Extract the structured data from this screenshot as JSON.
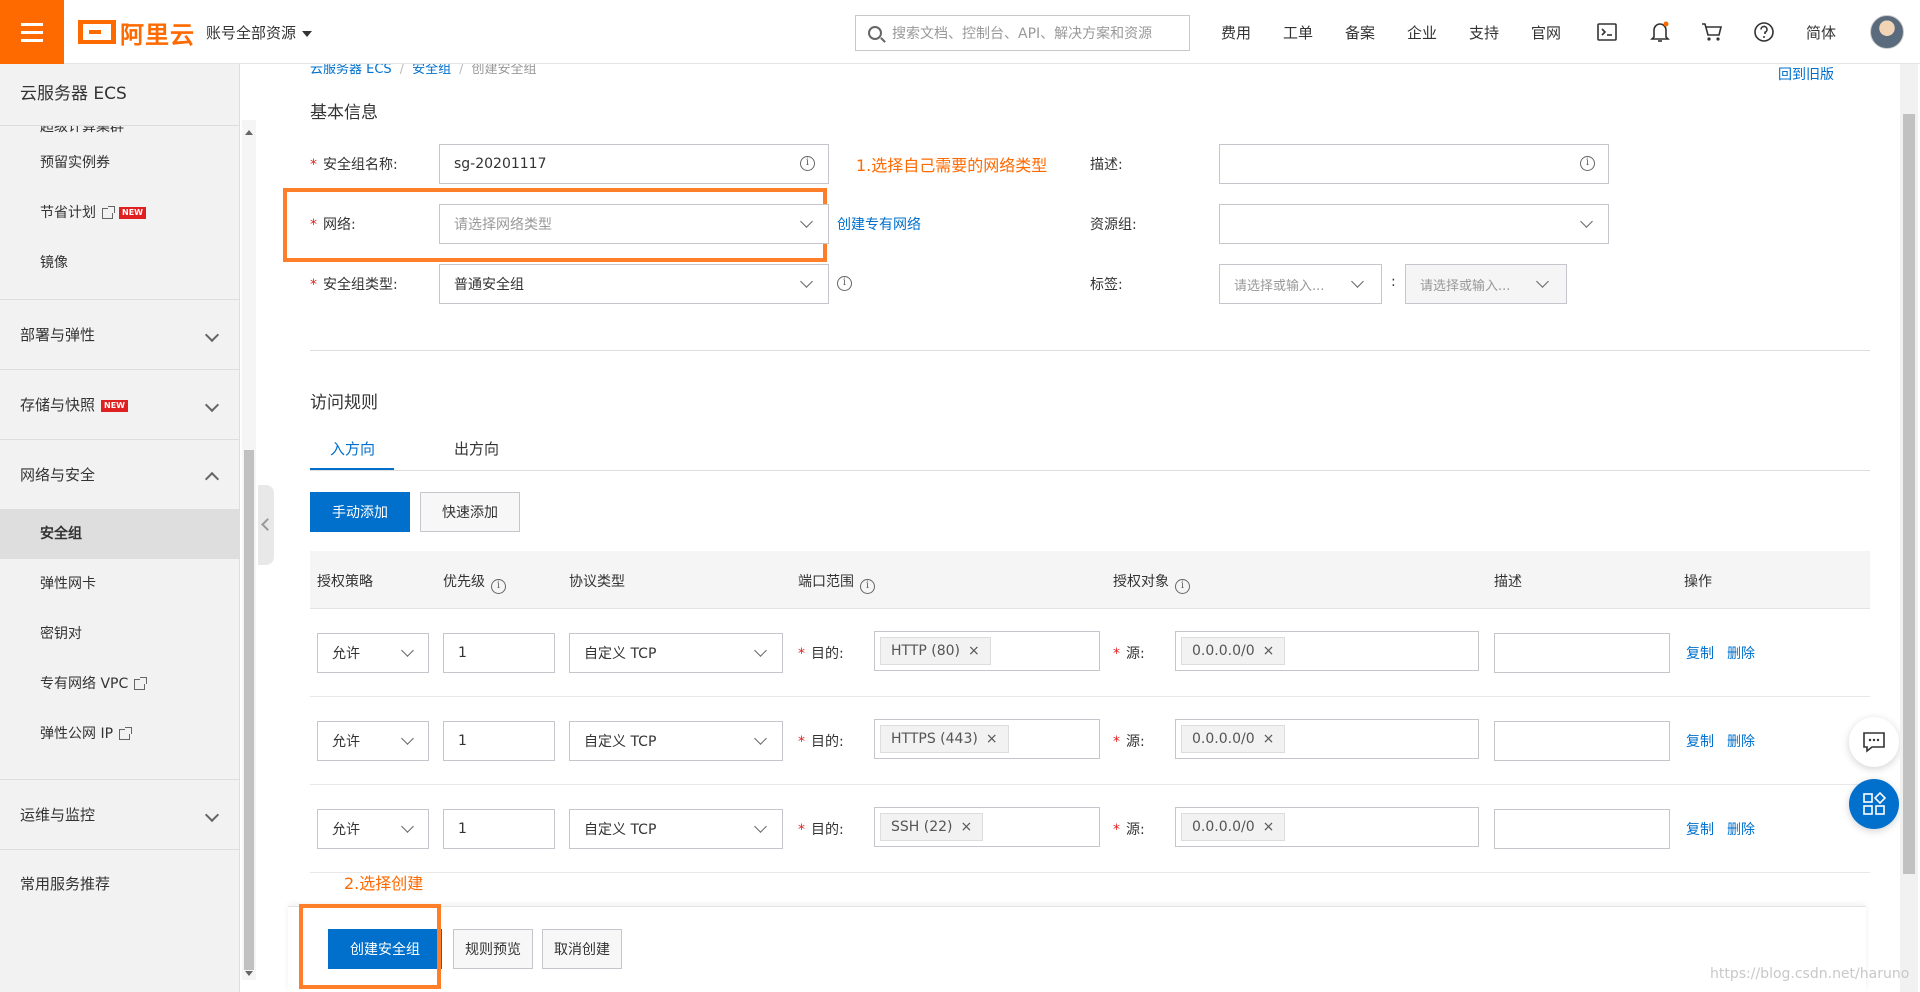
{
  "header": {
    "logo_text": "阿里云",
    "account_menu": "账号全部资源",
    "search_placeholder": "搜索文档、控制台、API、解决方案和资源",
    "nav": [
      "费用",
      "工单",
      "备案",
      "企业",
      "支持",
      "官网"
    ],
    "lang": "简体",
    "icons": [
      "terminal-icon",
      "bell-icon",
      "cart-icon",
      "help-icon"
    ]
  },
  "sidebar": {
    "title": "云服务器 ECS",
    "partial_item": "超级计算集群",
    "items_top": [
      {
        "label": "预留实例券"
      },
      {
        "label": "节省计划",
        "external": true,
        "badge": "NEW"
      },
      {
        "label": "镜像"
      }
    ],
    "groups": [
      {
        "label": "部署与弹性"
      },
      {
        "label": "存储与快照",
        "badge": "NEW"
      },
      {
        "label": "网络与安全",
        "expanded": true
      }
    ],
    "network_items": [
      {
        "label": "安全组",
        "active": true
      },
      {
        "label": "弹性网卡"
      },
      {
        "label": "密钥对"
      },
      {
        "label": "专有网络 VPC",
        "external": true
      },
      {
        "label": "弹性公网 IP",
        "external": true
      }
    ],
    "groups_bottom": [
      {
        "label": "运维与监控"
      },
      {
        "label": "常用服务推荐"
      }
    ]
  },
  "breadcrumb": [
    "云服务器 ECS",
    "安全组",
    "创建安全组"
  ],
  "back_old": "回到旧版",
  "basic": {
    "title": "基本信息",
    "name_label": "安全组名称:",
    "name_value": "sg-20201117",
    "network_label": "网络:",
    "network_placeholder": "请选择网络类型",
    "create_vpc": "创建专有网络",
    "type_label": "安全组类型:",
    "type_value": "普通安全组",
    "desc_label": "描述:",
    "resgroup_label": "资源组:",
    "tags_label": "标签:",
    "tag_key_placeholder": "请选择或输入...",
    "tag_sep": ":",
    "tag_value_placeholder": "请选择或输入..."
  },
  "annotations": {
    "step1": "1.选择自己需要的网络类型",
    "step2": "2.选择创建"
  },
  "rules": {
    "title": "访问规则",
    "tabs": [
      "入方向",
      "出方向"
    ],
    "add_manual": "手动添加",
    "add_quick": "快速添加",
    "headers": [
      "授权策略",
      "优先级",
      "协议类型",
      "端口范围",
      "授权对象",
      "描述",
      "操作"
    ],
    "dest_label": "目的:",
    "src_label": "源:",
    "copy": "复制",
    "delete": "删除",
    "rows": [
      {
        "policy": "允许",
        "priority": "1",
        "protocol": "自定义 TCP",
        "port": "HTTP (80)",
        "source": "0.0.0.0/0"
      },
      {
        "policy": "允许",
        "priority": "1",
        "protocol": "自定义 TCP",
        "port": "HTTPS (443)",
        "source": "0.0.0.0/0"
      },
      {
        "policy": "允许",
        "priority": "1",
        "protocol": "自定义 TCP",
        "port": "SSH (22)",
        "source": "0.0.0.0/0"
      }
    ]
  },
  "footer": {
    "create": "创建安全组",
    "preview": "规则预览",
    "cancel": "取消创建"
  },
  "watermark": "https://blog.csdn.net/haruno",
  "colors": {
    "brand": "#ff6a00",
    "primary": "#0070cc",
    "annotation": "#ff7e29"
  }
}
